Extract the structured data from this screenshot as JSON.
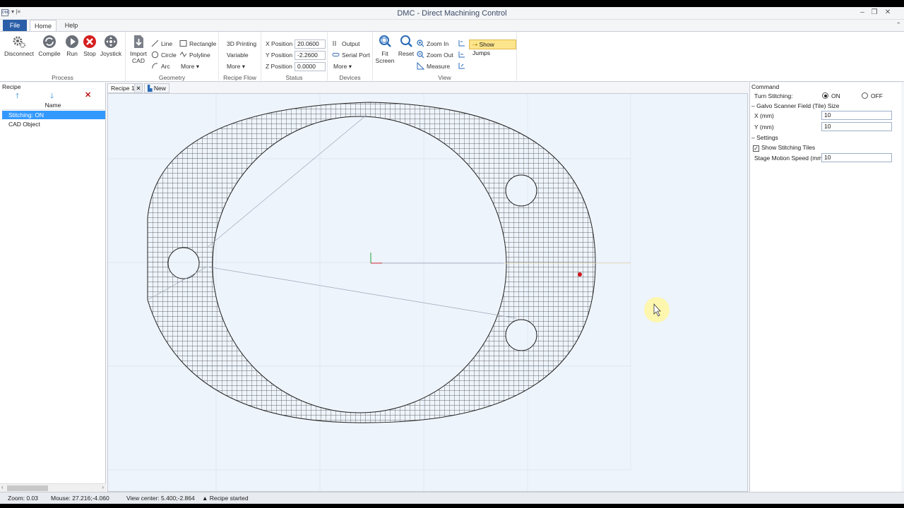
{
  "window": {
    "title": "DMC - Direct Machining Control",
    "app_icon": "DMC",
    "quick_access": "▾ |≡"
  },
  "ribbon_tabs": {
    "file": "File",
    "home": "Home",
    "help": "Help"
  },
  "process": {
    "label": "Process",
    "disconnect": "Disconnect",
    "compile": "Compile",
    "run": "Run",
    "stop": "Stop",
    "joystick": "Joystick"
  },
  "geometry": {
    "label": "Geometry",
    "import_cad_1": "Import",
    "import_cad_2": "CAD",
    "line": "Line",
    "circle": "Circle",
    "arc": "Arc",
    "rectangle": "Rectangle",
    "polyline": "Polyline",
    "more": "More"
  },
  "recipe_flow": {
    "label": "Recipe Flow",
    "printing": "3D Printing",
    "variable": "Variable",
    "more": "More"
  },
  "status": {
    "label": "Status",
    "x_label": "X Position",
    "x_value": "20.0600",
    "y_label": "Y Position",
    "y_value": "-2.2600",
    "z_label": "Z Position",
    "z_value": "0.0000"
  },
  "devices": {
    "label": "Devices",
    "output": "Output",
    "serial": "Serial Port",
    "more": "More"
  },
  "view": {
    "label": "View",
    "fit_1": "Fit",
    "fit_2": "Screen",
    "reset": "Reset",
    "zoom_in": "Zoom In",
    "zoom_out": "Zoom Out",
    "measure": "Measure",
    "show_jumps": "Show Jumps"
  },
  "recipe_panel": {
    "title": "Recipe",
    "column": "Name",
    "items": [
      "Stitching: ON",
      "CAD Object"
    ]
  },
  "doc_tabs": {
    "recipe1": "Recipe 1",
    "new": "New"
  },
  "command_panel": {
    "title": "Command",
    "turn_stitching": "Turn Stitching:",
    "on": "ON",
    "off": "OFF",
    "galvo_section": "Galvo Scanner Field (Tile) Size",
    "x_label": "X (mm)",
    "x_value": "10",
    "y_label": "Y (mm)",
    "y_value": "10",
    "settings_section": "Settings",
    "show_tiles": "Show Stitching Tiles",
    "stage_speed_label": "Stage Motion Speed (mm/s)",
    "stage_speed_value": "10"
  },
  "statusbar": {
    "zoom": "Zoom: 0.03",
    "mouse": "Mouse: 27.216;-4.060",
    "view_center": "View center: 5.400;-2.864",
    "recipe_state": "Recipe started"
  },
  "colors": {
    "accent": "#2a5ea8",
    "selection": "#3399ff",
    "show_jumps": "#fde58b",
    "canvas": "#eef4fb",
    "stop": "#d42020"
  }
}
